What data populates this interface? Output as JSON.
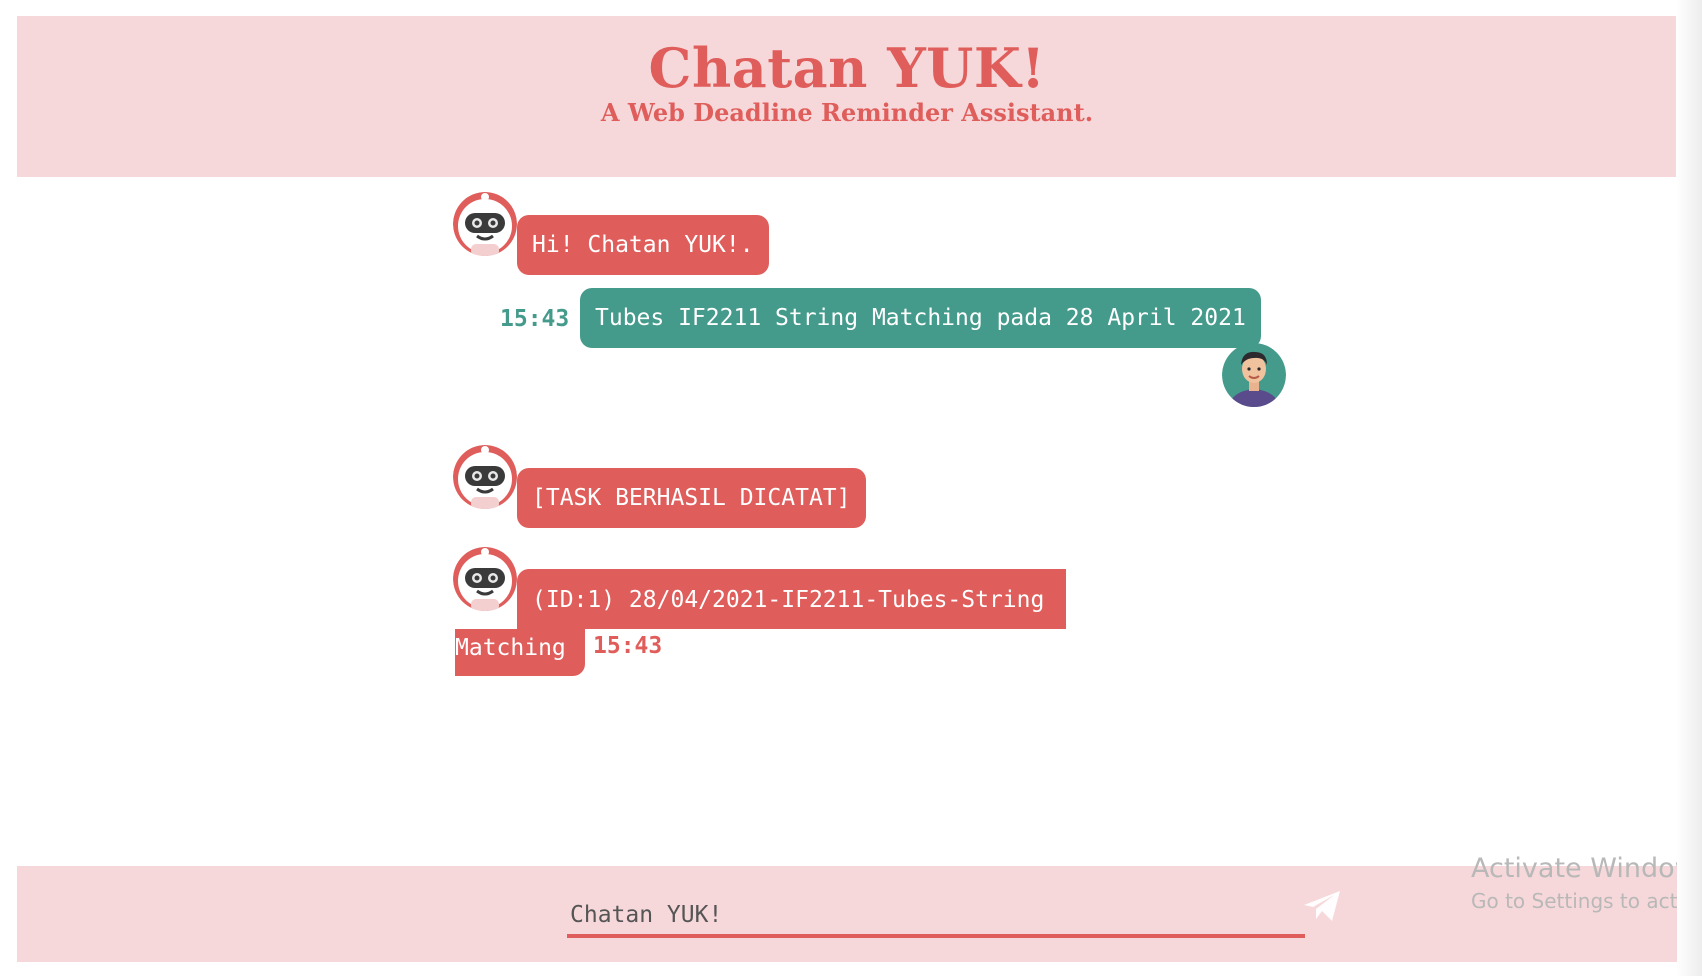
{
  "header": {
    "title": "Chatan YUK!",
    "subtitle": "A Web Deadline Reminder Assistant."
  },
  "messages": [
    {
      "sender": "bot",
      "text": "Hi! Chatan YUK!.",
      "avatar": "robot-avatar-icon"
    },
    {
      "sender": "user",
      "text": "Tubes IF2211 String Matching pada 28 April 2021",
      "time": "15:43",
      "avatar": "user-avatar-icon"
    },
    {
      "sender": "bot",
      "text": "[TASK BERHASIL DICATAT]",
      "avatar": "robot-avatar-icon"
    },
    {
      "sender": "bot",
      "text_line1": "(ID:1) 28/04/2021-IF2211-Tubes-String",
      "text_line2": "Matching",
      "time": "15:43",
      "avatar": "robot-avatar-icon"
    }
  ],
  "input": {
    "value": "",
    "placeholder": "Chatan YUK!",
    "send_icon": "paper-plane-icon"
  },
  "watermark": {
    "title": "Activate Windows",
    "subtitle": "Go to Settings to activate Windows."
  },
  "colors": {
    "accent": "#df5e5b",
    "header_bg": "#f7d8da",
    "user_bubble": "#449b8c",
    "bot_bubble": "#df5e5b"
  }
}
